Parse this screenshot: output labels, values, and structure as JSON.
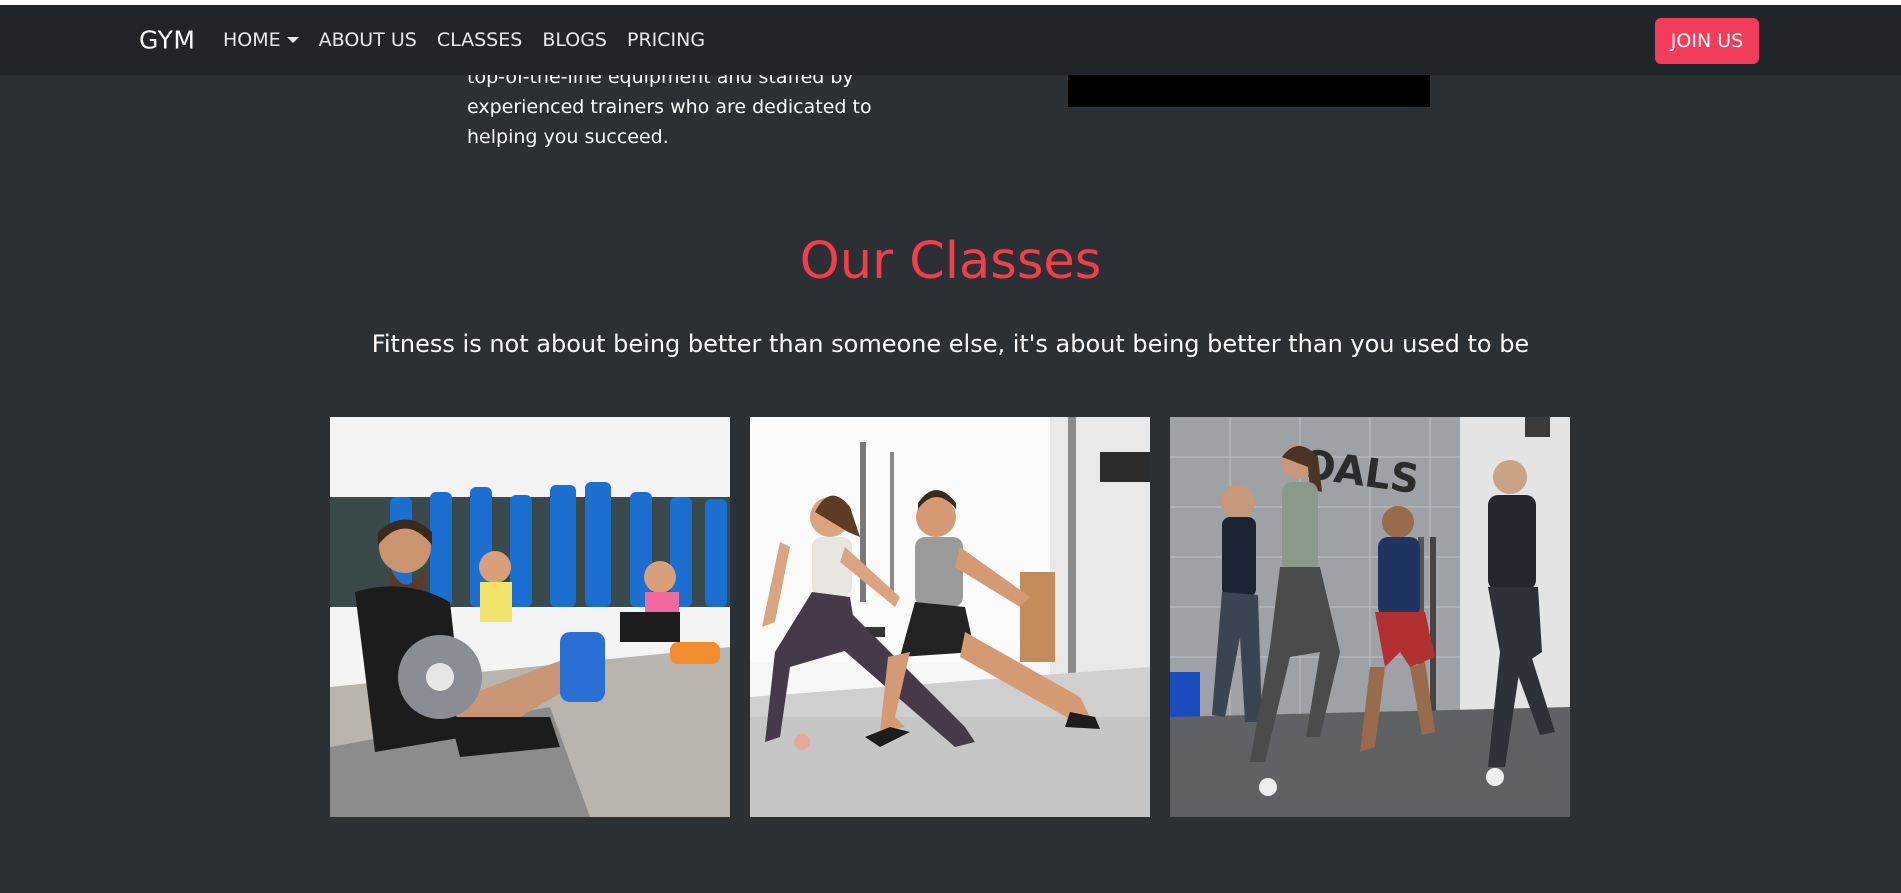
{
  "navbar": {
    "brand": "GYM",
    "items": [
      {
        "label": "HOME",
        "has_dropdown": true
      },
      {
        "label": "ABOUT US"
      },
      {
        "label": "CLASSES"
      },
      {
        "label": "BLOGS"
      },
      {
        "label": "PRICING"
      }
    ],
    "cta_label": "JOIN US"
  },
  "about": {
    "lines": [
      "top-of-the-line equipment and staffed by",
      "experienced trainers who are dedicated to",
      "helping you succeed."
    ]
  },
  "classes": {
    "title": "Our Classes",
    "subtitle": "Fitness is not about being better than someone else, it's about being better than you used to be",
    "cards": [
      {
        "image": "class-photo-core-workout"
      },
      {
        "image": "class-photo-stretching"
      },
      {
        "image": "class-photo-lunges"
      }
    ]
  },
  "colors": {
    "background": "#2b3035",
    "navbar": "#212529",
    "accent": "#f23d5a",
    "title": "#f23d4b"
  }
}
